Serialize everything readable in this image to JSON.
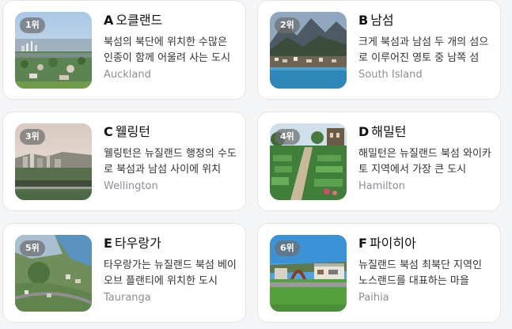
{
  "places": [
    {
      "rank": "1위",
      "letter": "A",
      "name": "오클랜드",
      "description": "북섬의 북단에 위치한 수많은 인종이 함께 어울려 사는 도시",
      "english": "Auckland"
    },
    {
      "rank": "2위",
      "letter": "B",
      "name": "남섬",
      "description": "크게 북섬과 남섬 두 개의 섬으로 이루어진 영토 중 남쪽 섬",
      "english": "South Island"
    },
    {
      "rank": "3위",
      "letter": "C",
      "name": "웰링턴",
      "description": "웰링턴은 뉴질랜드 행정의 수도로 북섬과 남섬 사이에 위치",
      "english": "Wellington"
    },
    {
      "rank": "4위",
      "letter": "D",
      "name": "해밀턴",
      "description": "해밀턴은 뉴질랜드 북섬 와이카토 지역에서 가장 큰 도시",
      "english": "Hamilton"
    },
    {
      "rank": "5위",
      "letter": "E",
      "name": "타우랑가",
      "description": "타우랑가는 뉴질랜드 북섬 베이 오브 플랜티에 위치한 도시",
      "english": "Tauranga"
    },
    {
      "rank": "6위",
      "letter": "F",
      "name": "파이히아",
      "description": "뉴질랜드 북섬 최북단 지역인 노스랜드를 대표하는 마을",
      "english": "Paihia"
    }
  ]
}
